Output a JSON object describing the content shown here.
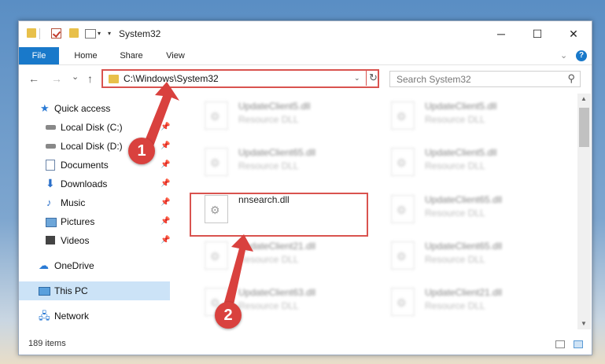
{
  "window": {
    "title": "System32",
    "controls": {
      "minimize": "─",
      "maximize": "☐",
      "close": "✕"
    }
  },
  "ribbon": {
    "tabs": [
      "File",
      "Home",
      "Share",
      "View"
    ],
    "help": "?"
  },
  "nav": {
    "back": "←",
    "forward": "→",
    "recent": "⌄",
    "up": "↑",
    "address": "C:\\Windows\\System32",
    "search_placeholder": "Search System32"
  },
  "sidebar": {
    "items": [
      {
        "label": "Quick access",
        "icon": "star-icon",
        "pinned": false
      },
      {
        "label": "Local Disk (C:)",
        "icon": "disk-icon",
        "pinned": true
      },
      {
        "label": "Local Disk (D:)",
        "icon": "disk-icon",
        "pinned": true
      },
      {
        "label": "Documents",
        "icon": "documents-icon",
        "pinned": true
      },
      {
        "label": "Downloads",
        "icon": "downloads-icon",
        "pinned": true
      },
      {
        "label": "Music",
        "icon": "music-icon",
        "pinned": true
      },
      {
        "label": "Pictures",
        "icon": "pictures-icon",
        "pinned": true
      },
      {
        "label": "Videos",
        "icon": "videos-icon",
        "pinned": true
      },
      {
        "label": "OneDrive",
        "icon": "onedrive-icon",
        "pinned": false
      },
      {
        "label": "This PC",
        "icon": "this-pc-icon",
        "pinned": false,
        "selected": true
      },
      {
        "label": "Network",
        "icon": "network-icon",
        "pinned": false
      }
    ]
  },
  "files": [
    {
      "name": "UpdateClient5.dll",
      "type": "Resource DLL",
      "blurred": true
    },
    {
      "name": "UpdateClient5.dll",
      "type": "Resource DLL",
      "blurred": true
    },
    {
      "name": "UpdateClient65.dll",
      "type": "Resource DLL",
      "blurred": true
    },
    {
      "name": "UpdateClient5.dll",
      "type": "Resource DLL",
      "blurred": true
    },
    {
      "name": "nnsearch.dll",
      "type": "",
      "blurred": false
    },
    {
      "name": "UpdateClient65.dll",
      "type": "Resource DLL",
      "blurred": true
    },
    {
      "name": "UpdateClient21.dll",
      "type": "Resource DLL",
      "blurred": true
    },
    {
      "name": "UpdateClient65.dll",
      "type": "Resource DLL",
      "blurred": true
    },
    {
      "name": "UpdateClient63.dll",
      "type": "Resource DLL",
      "blurred": true
    },
    {
      "name": "UpdateClient21.dll",
      "type": "Resource DLL",
      "blurred": true
    }
  ],
  "status": {
    "item_count": "189 items"
  },
  "annotations": {
    "step1": "1",
    "step2": "2",
    "color": "#d9413e"
  }
}
